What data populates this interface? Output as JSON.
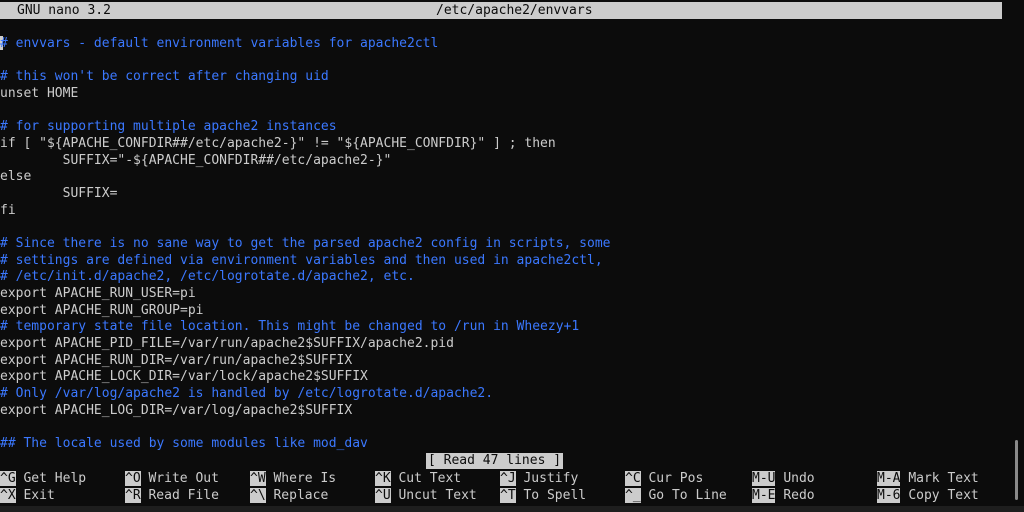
{
  "titlebar": {
    "app": "GNU nano 3.2",
    "file": "/etc/apache2/envvars"
  },
  "lines": [
    {
      "text": "",
      "type": "blank"
    },
    {
      "text": "# envvars - default environment variables for apache2ctl",
      "type": "comment"
    },
    {
      "text": "",
      "type": "blank"
    },
    {
      "text": "# this won't be correct after changing uid",
      "type": "comment"
    },
    {
      "text": "unset HOME",
      "type": "code"
    },
    {
      "text": "",
      "type": "blank"
    },
    {
      "text": "# for supporting multiple apache2 instances",
      "type": "comment"
    },
    {
      "text": "if [ \"${APACHE_CONFDIR##/etc/apache2-}\" != \"${APACHE_CONFDIR}\" ] ; then",
      "type": "code"
    },
    {
      "text": "        SUFFIX=\"-${APACHE_CONFDIR##/etc/apache2-}\"",
      "type": "code"
    },
    {
      "text": "else",
      "type": "code"
    },
    {
      "text": "        SUFFIX=",
      "type": "code"
    },
    {
      "text": "fi",
      "type": "code"
    },
    {
      "text": "",
      "type": "blank"
    },
    {
      "text": "# Since there is no sane way to get the parsed apache2 config in scripts, some",
      "type": "comment"
    },
    {
      "text": "# settings are defined via environment variables and then used in apache2ctl,",
      "type": "comment"
    },
    {
      "text": "# /etc/init.d/apache2, /etc/logrotate.d/apache2, etc.",
      "type": "comment"
    },
    {
      "text": "export APACHE_RUN_USER=pi",
      "type": "code"
    },
    {
      "text": "export APACHE_RUN_GROUP=pi",
      "type": "code"
    },
    {
      "text": "# temporary state file location. This might be changed to /run in Wheezy+1",
      "type": "comment"
    },
    {
      "text": "export APACHE_PID_FILE=/var/run/apache2$SUFFIX/apache2.pid",
      "type": "code"
    },
    {
      "text": "export APACHE_RUN_DIR=/var/run/apache2$SUFFIX",
      "type": "code"
    },
    {
      "text": "export APACHE_LOCK_DIR=/var/lock/apache2$SUFFIX",
      "type": "code"
    },
    {
      "text": "# Only /var/log/apache2 is handled by /etc/logrotate.d/apache2.",
      "type": "comment"
    },
    {
      "text": "export APACHE_LOG_DIR=/var/log/apache2$SUFFIX",
      "type": "code"
    },
    {
      "text": "",
      "type": "blank"
    },
    {
      "text": "## The locale used by some modules like mod_dav",
      "type": "comment"
    }
  ],
  "status": "[ Read 47 lines ]",
  "shortcuts": [
    {
      "key": "^G",
      "label": "Get Help"
    },
    {
      "key": "^X",
      "label": "Exit"
    },
    {
      "key": "^O",
      "label": "Write Out"
    },
    {
      "key": "^R",
      "label": "Read File"
    },
    {
      "key": "^W",
      "label": "Where Is"
    },
    {
      "key": "^\\",
      "label": "Replace"
    },
    {
      "key": "^K",
      "label": "Cut Text"
    },
    {
      "key": "^U",
      "label": "Uncut Text"
    },
    {
      "key": "^J",
      "label": "Justify"
    },
    {
      "key": "^T",
      "label": "To Spell"
    },
    {
      "key": "^C",
      "label": "Cur Pos"
    },
    {
      "key": "^_",
      "label": "Go To Line"
    },
    {
      "key": "M-U",
      "label": "Undo"
    },
    {
      "key": "M-E",
      "label": "Redo"
    },
    {
      "key": "M-A",
      "label": "Mark Text"
    },
    {
      "key": "M-6",
      "label": "Copy Text"
    }
  ],
  "colors": {
    "background": "#0c0c0c",
    "foreground": "#cccccc",
    "comment": "#3b78ff",
    "bar": "#cccccc"
  }
}
